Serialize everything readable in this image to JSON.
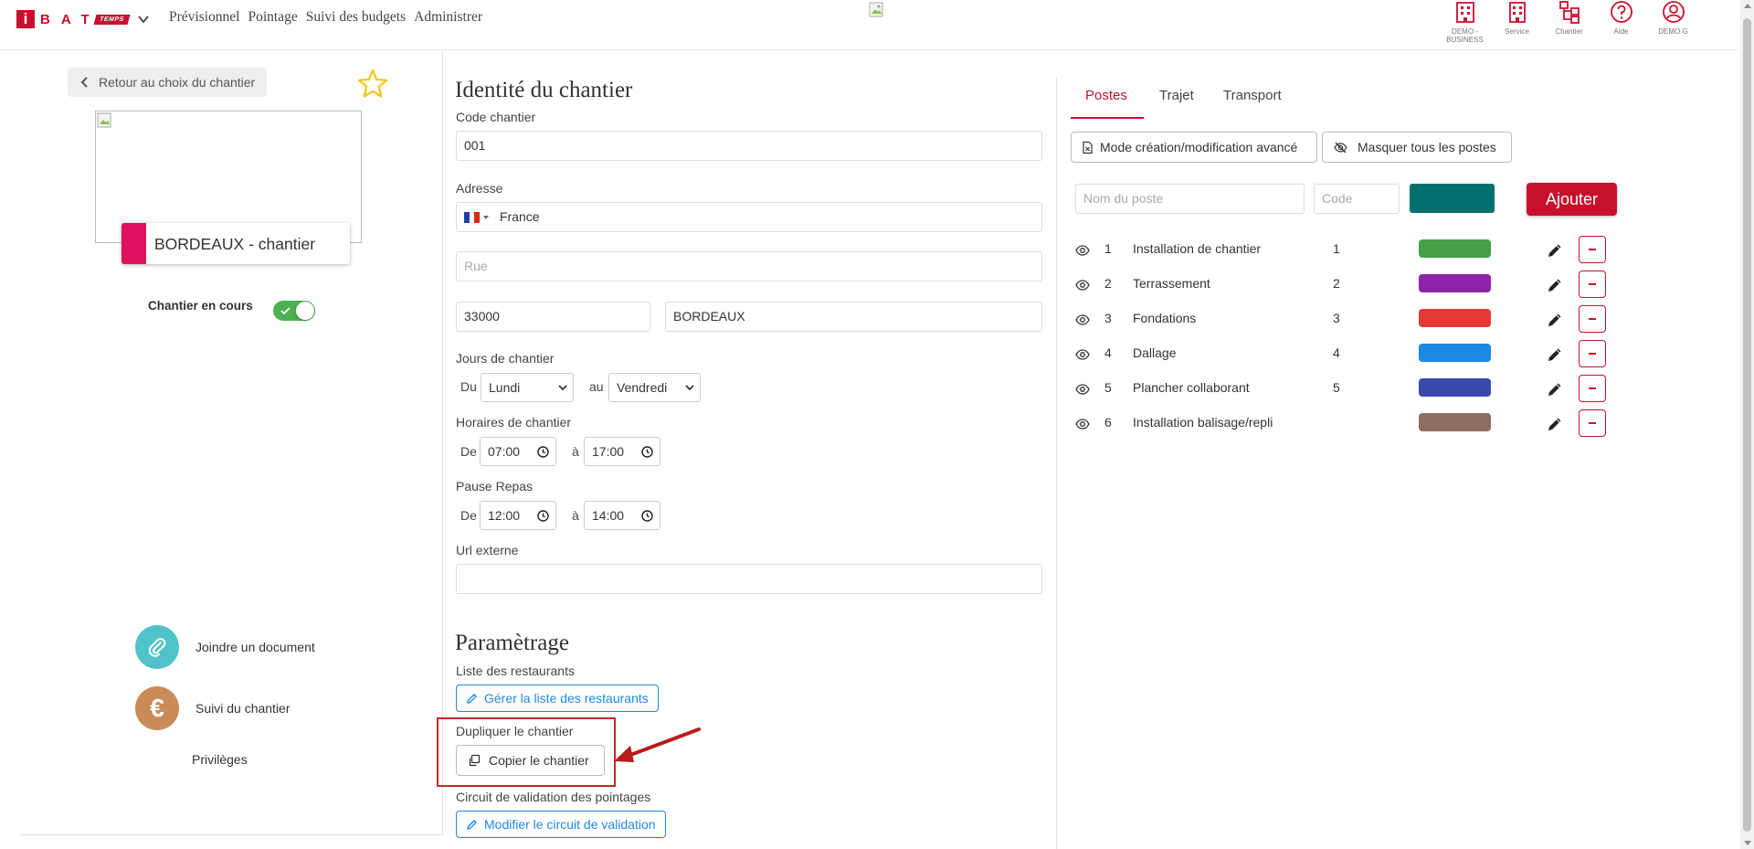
{
  "topbar": {
    "logo_i": "i",
    "logo_letters": "BAT",
    "logo_tag": "TEMPS",
    "menu": [
      "Prévisionnel",
      "Pointage",
      "Suivi des budgets",
      "Administrer"
    ],
    "icons": [
      {
        "icon": "building-icon",
        "label_line1": "DEMO -",
        "label_line2": "BUSINESS"
      },
      {
        "icon": "building-icon",
        "label_line1": "Service",
        "label_line2": ""
      },
      {
        "icon": "sitemap-icon",
        "label_line1": "Chantier",
        "label_line2": ""
      },
      {
        "icon": "help-circle-icon",
        "label_line1": "Aide",
        "label_line2": ""
      },
      {
        "icon": "user-circle-icon",
        "label_line1": "DEMO G",
        "label_line2": ""
      }
    ]
  },
  "left": {
    "back_label": "Retour au choix du chantier",
    "site_name": "BORDEAUX - chantier",
    "status_label": "Chantier en cours",
    "status_on": true,
    "attach_label": "Joindre un document",
    "follow_label": "Suivi du chantier",
    "follow_symbol": "€",
    "privileges_label": "Privilèges",
    "colors": {
      "site": "#e0115f",
      "attach": "#4fc3c8",
      "follow": "#c98b57",
      "toggle": "#4caf50"
    }
  },
  "identity": {
    "title": "Identité du chantier",
    "code_label": "Code chantier",
    "code_value": "001",
    "address_label": "Adresse",
    "country": "France",
    "street_placeholder": "Rue",
    "postal_code": "33000",
    "city": "BORDEAUX",
    "days_label": "Jours de chantier",
    "from_label": "Du",
    "day_from": "Lundi",
    "to_label": "au",
    "day_to": "Vendredi",
    "hours_label": "Horaires de chantier",
    "hours_from_prefix": "De",
    "hours_from": "07:00",
    "hours_to_prefix": "à",
    "hours_to": "17:00",
    "break_label": "Pause Repas",
    "break_from_prefix": "De",
    "break_from": "12:00",
    "break_to_prefix": "à",
    "break_to": "14:00",
    "url_label": "Url externe",
    "url_value": ""
  },
  "settings": {
    "title": "Paramètrage",
    "restaurants_label": "Liste des restaurants",
    "restaurants_button": "Gérer la liste des restaurants",
    "duplicate_label": "Dupliquer le chantier",
    "copy_button": "Copier le chantier",
    "validation_label": "Circuit de validation des pointages",
    "validation_button": "Modifier le circuit de validation"
  },
  "right": {
    "tabs": [
      "Postes",
      "Trajet",
      "Transport"
    ],
    "active_tab": "Postes",
    "advanced_mode_button": "Mode création/modification avancé",
    "hide_all_button": "Masquer tous les postes",
    "name_placeholder": "Nom du poste",
    "code_placeholder": "Code",
    "new_color": "#00706e",
    "add_button": "Ajouter",
    "postes": [
      {
        "num": "1",
        "label": "Installation de chantier",
        "code": "1",
        "color": "#43a047"
      },
      {
        "num": "2",
        "label": "Terrassement",
        "code": "2",
        "color": "#8e24aa"
      },
      {
        "num": "3",
        "label": "Fondations",
        "code": "3",
        "color": "#e53935"
      },
      {
        "num": "4",
        "label": "Dallage",
        "code": "4",
        "color": "#1e88e5"
      },
      {
        "num": "5",
        "label": "Plancher collaborant",
        "code": "5",
        "color": "#3949ab"
      },
      {
        "num": "6",
        "label": "Installation balisage/repli",
        "code": "",
        "color": "#8d6e63"
      }
    ]
  }
}
